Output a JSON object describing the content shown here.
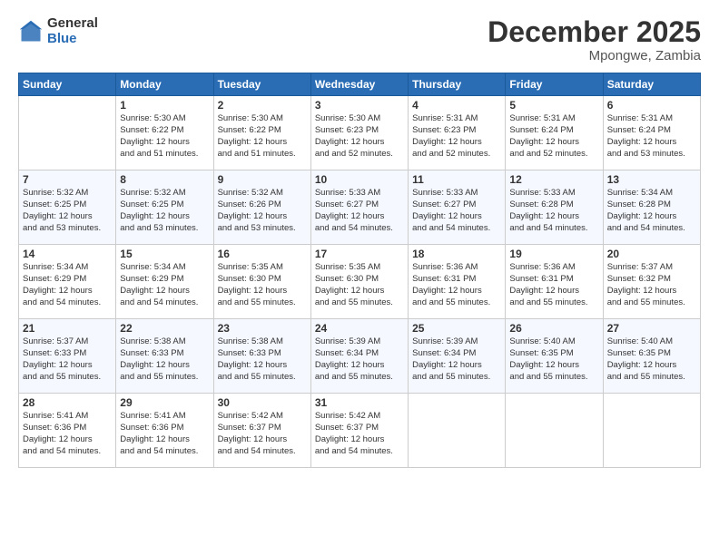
{
  "logo": {
    "general": "General",
    "blue": "Blue"
  },
  "header": {
    "title": "December 2025",
    "subtitle": "Mpongwe, Zambia"
  },
  "weekdays": [
    "Sunday",
    "Monday",
    "Tuesday",
    "Wednesday",
    "Thursday",
    "Friday",
    "Saturday"
  ],
  "weeks": [
    [
      {
        "day": "",
        "sunrise": "",
        "sunset": "",
        "daylight": ""
      },
      {
        "day": "1",
        "sunrise": "Sunrise: 5:30 AM",
        "sunset": "Sunset: 6:22 PM",
        "daylight": "Daylight: 12 hours and 51 minutes."
      },
      {
        "day": "2",
        "sunrise": "Sunrise: 5:30 AM",
        "sunset": "Sunset: 6:22 PM",
        "daylight": "Daylight: 12 hours and 51 minutes."
      },
      {
        "day": "3",
        "sunrise": "Sunrise: 5:30 AM",
        "sunset": "Sunset: 6:23 PM",
        "daylight": "Daylight: 12 hours and 52 minutes."
      },
      {
        "day": "4",
        "sunrise": "Sunrise: 5:31 AM",
        "sunset": "Sunset: 6:23 PM",
        "daylight": "Daylight: 12 hours and 52 minutes."
      },
      {
        "day": "5",
        "sunrise": "Sunrise: 5:31 AM",
        "sunset": "Sunset: 6:24 PM",
        "daylight": "Daylight: 12 hours and 52 minutes."
      },
      {
        "day": "6",
        "sunrise": "Sunrise: 5:31 AM",
        "sunset": "Sunset: 6:24 PM",
        "daylight": "Daylight: 12 hours and 53 minutes."
      }
    ],
    [
      {
        "day": "7",
        "sunrise": "Sunrise: 5:32 AM",
        "sunset": "Sunset: 6:25 PM",
        "daylight": "Daylight: 12 hours and 53 minutes."
      },
      {
        "day": "8",
        "sunrise": "Sunrise: 5:32 AM",
        "sunset": "Sunset: 6:25 PM",
        "daylight": "Daylight: 12 hours and 53 minutes."
      },
      {
        "day": "9",
        "sunrise": "Sunrise: 5:32 AM",
        "sunset": "Sunset: 6:26 PM",
        "daylight": "Daylight: 12 hours and 53 minutes."
      },
      {
        "day": "10",
        "sunrise": "Sunrise: 5:33 AM",
        "sunset": "Sunset: 6:27 PM",
        "daylight": "Daylight: 12 hours and 54 minutes."
      },
      {
        "day": "11",
        "sunrise": "Sunrise: 5:33 AM",
        "sunset": "Sunset: 6:27 PM",
        "daylight": "Daylight: 12 hours and 54 minutes."
      },
      {
        "day": "12",
        "sunrise": "Sunrise: 5:33 AM",
        "sunset": "Sunset: 6:28 PM",
        "daylight": "Daylight: 12 hours and 54 minutes."
      },
      {
        "day": "13",
        "sunrise": "Sunrise: 5:34 AM",
        "sunset": "Sunset: 6:28 PM",
        "daylight": "Daylight: 12 hours and 54 minutes."
      }
    ],
    [
      {
        "day": "14",
        "sunrise": "Sunrise: 5:34 AM",
        "sunset": "Sunset: 6:29 PM",
        "daylight": "Daylight: 12 hours and 54 minutes."
      },
      {
        "day": "15",
        "sunrise": "Sunrise: 5:34 AM",
        "sunset": "Sunset: 6:29 PM",
        "daylight": "Daylight: 12 hours and 54 minutes."
      },
      {
        "day": "16",
        "sunrise": "Sunrise: 5:35 AM",
        "sunset": "Sunset: 6:30 PM",
        "daylight": "Daylight: 12 hours and 55 minutes."
      },
      {
        "day": "17",
        "sunrise": "Sunrise: 5:35 AM",
        "sunset": "Sunset: 6:30 PM",
        "daylight": "Daylight: 12 hours and 55 minutes."
      },
      {
        "day": "18",
        "sunrise": "Sunrise: 5:36 AM",
        "sunset": "Sunset: 6:31 PM",
        "daylight": "Daylight: 12 hours and 55 minutes."
      },
      {
        "day": "19",
        "sunrise": "Sunrise: 5:36 AM",
        "sunset": "Sunset: 6:31 PM",
        "daylight": "Daylight: 12 hours and 55 minutes."
      },
      {
        "day": "20",
        "sunrise": "Sunrise: 5:37 AM",
        "sunset": "Sunset: 6:32 PM",
        "daylight": "Daylight: 12 hours and 55 minutes."
      }
    ],
    [
      {
        "day": "21",
        "sunrise": "Sunrise: 5:37 AM",
        "sunset": "Sunset: 6:33 PM",
        "daylight": "Daylight: 12 hours and 55 minutes."
      },
      {
        "day": "22",
        "sunrise": "Sunrise: 5:38 AM",
        "sunset": "Sunset: 6:33 PM",
        "daylight": "Daylight: 12 hours and 55 minutes."
      },
      {
        "day": "23",
        "sunrise": "Sunrise: 5:38 AM",
        "sunset": "Sunset: 6:33 PM",
        "daylight": "Daylight: 12 hours and 55 minutes."
      },
      {
        "day": "24",
        "sunrise": "Sunrise: 5:39 AM",
        "sunset": "Sunset: 6:34 PM",
        "daylight": "Daylight: 12 hours and 55 minutes."
      },
      {
        "day": "25",
        "sunrise": "Sunrise: 5:39 AM",
        "sunset": "Sunset: 6:34 PM",
        "daylight": "Daylight: 12 hours and 55 minutes."
      },
      {
        "day": "26",
        "sunrise": "Sunrise: 5:40 AM",
        "sunset": "Sunset: 6:35 PM",
        "daylight": "Daylight: 12 hours and 55 minutes."
      },
      {
        "day": "27",
        "sunrise": "Sunrise: 5:40 AM",
        "sunset": "Sunset: 6:35 PM",
        "daylight": "Daylight: 12 hours and 55 minutes."
      }
    ],
    [
      {
        "day": "28",
        "sunrise": "Sunrise: 5:41 AM",
        "sunset": "Sunset: 6:36 PM",
        "daylight": "Daylight: 12 hours and 54 minutes."
      },
      {
        "day": "29",
        "sunrise": "Sunrise: 5:41 AM",
        "sunset": "Sunset: 6:36 PM",
        "daylight": "Daylight: 12 hours and 54 minutes."
      },
      {
        "day": "30",
        "sunrise": "Sunrise: 5:42 AM",
        "sunset": "Sunset: 6:37 PM",
        "daylight": "Daylight: 12 hours and 54 minutes."
      },
      {
        "day": "31",
        "sunrise": "Sunrise: 5:42 AM",
        "sunset": "Sunset: 6:37 PM",
        "daylight": "Daylight: 12 hours and 54 minutes."
      },
      {
        "day": "",
        "sunrise": "",
        "sunset": "",
        "daylight": ""
      },
      {
        "day": "",
        "sunrise": "",
        "sunset": "",
        "daylight": ""
      },
      {
        "day": "",
        "sunrise": "",
        "sunset": "",
        "daylight": ""
      }
    ]
  ]
}
